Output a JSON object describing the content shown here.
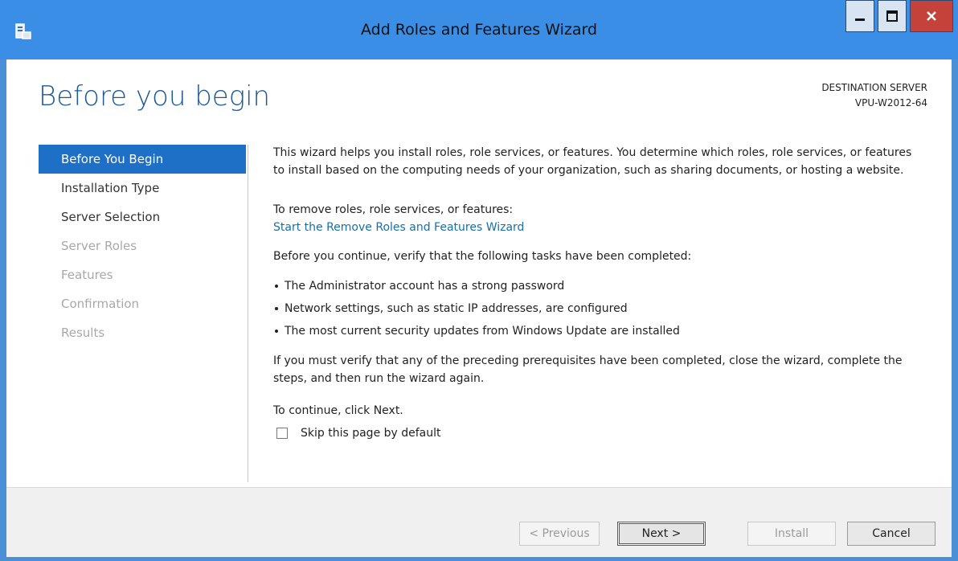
{
  "window": {
    "title": "Add Roles and Features Wizard",
    "controls": {
      "minimize": "minimize-icon",
      "maximize": "maximize-icon",
      "close": "close-icon"
    }
  },
  "header": {
    "page_title": "Before you begin",
    "destination_label": "DESTINATION SERVER",
    "destination_server": "VPU-W2012-64"
  },
  "nav": {
    "items": [
      {
        "label": "Before You Begin",
        "state": "active"
      },
      {
        "label": "Installation Type",
        "state": "enabled"
      },
      {
        "label": "Server Selection",
        "state": "enabled"
      },
      {
        "label": "Server Roles",
        "state": "disabled"
      },
      {
        "label": "Features",
        "state": "disabled"
      },
      {
        "label": "Confirmation",
        "state": "disabled"
      },
      {
        "label": "Results",
        "state": "disabled"
      }
    ]
  },
  "content": {
    "intro": "This wizard helps you install roles, role services, or features. You determine which roles, role services, or features to install based on the computing needs of your organization, such as sharing documents, or hosting a website.",
    "remove_label": "To remove roles, role services, or features:",
    "remove_link": "Start the Remove Roles and Features Wizard",
    "verify_text": "Before you continue, verify that the following tasks have been completed:",
    "bullets": [
      "The Administrator account has a strong password",
      "Network settings, such as static IP addresses, are configured",
      "The most current security updates from Windows Update are installed"
    ],
    "prereq_text": "If you must verify that any of the preceding prerequisites have been completed, close the wizard, complete the steps, and then run the wizard again.",
    "continue_text": "To continue, click Next.",
    "skip_checkbox_label": "Skip this page by default",
    "skip_checked": false
  },
  "footer": {
    "previous": "< Previous",
    "next": "Next >",
    "install": "Install",
    "cancel": "Cancel"
  },
  "colors": {
    "title_bar": "#3a8ee6",
    "active_nav": "#1e6fc6",
    "page_title": "#1e5a96",
    "link": "#1a6ea8",
    "close_button": "#c4423a"
  }
}
